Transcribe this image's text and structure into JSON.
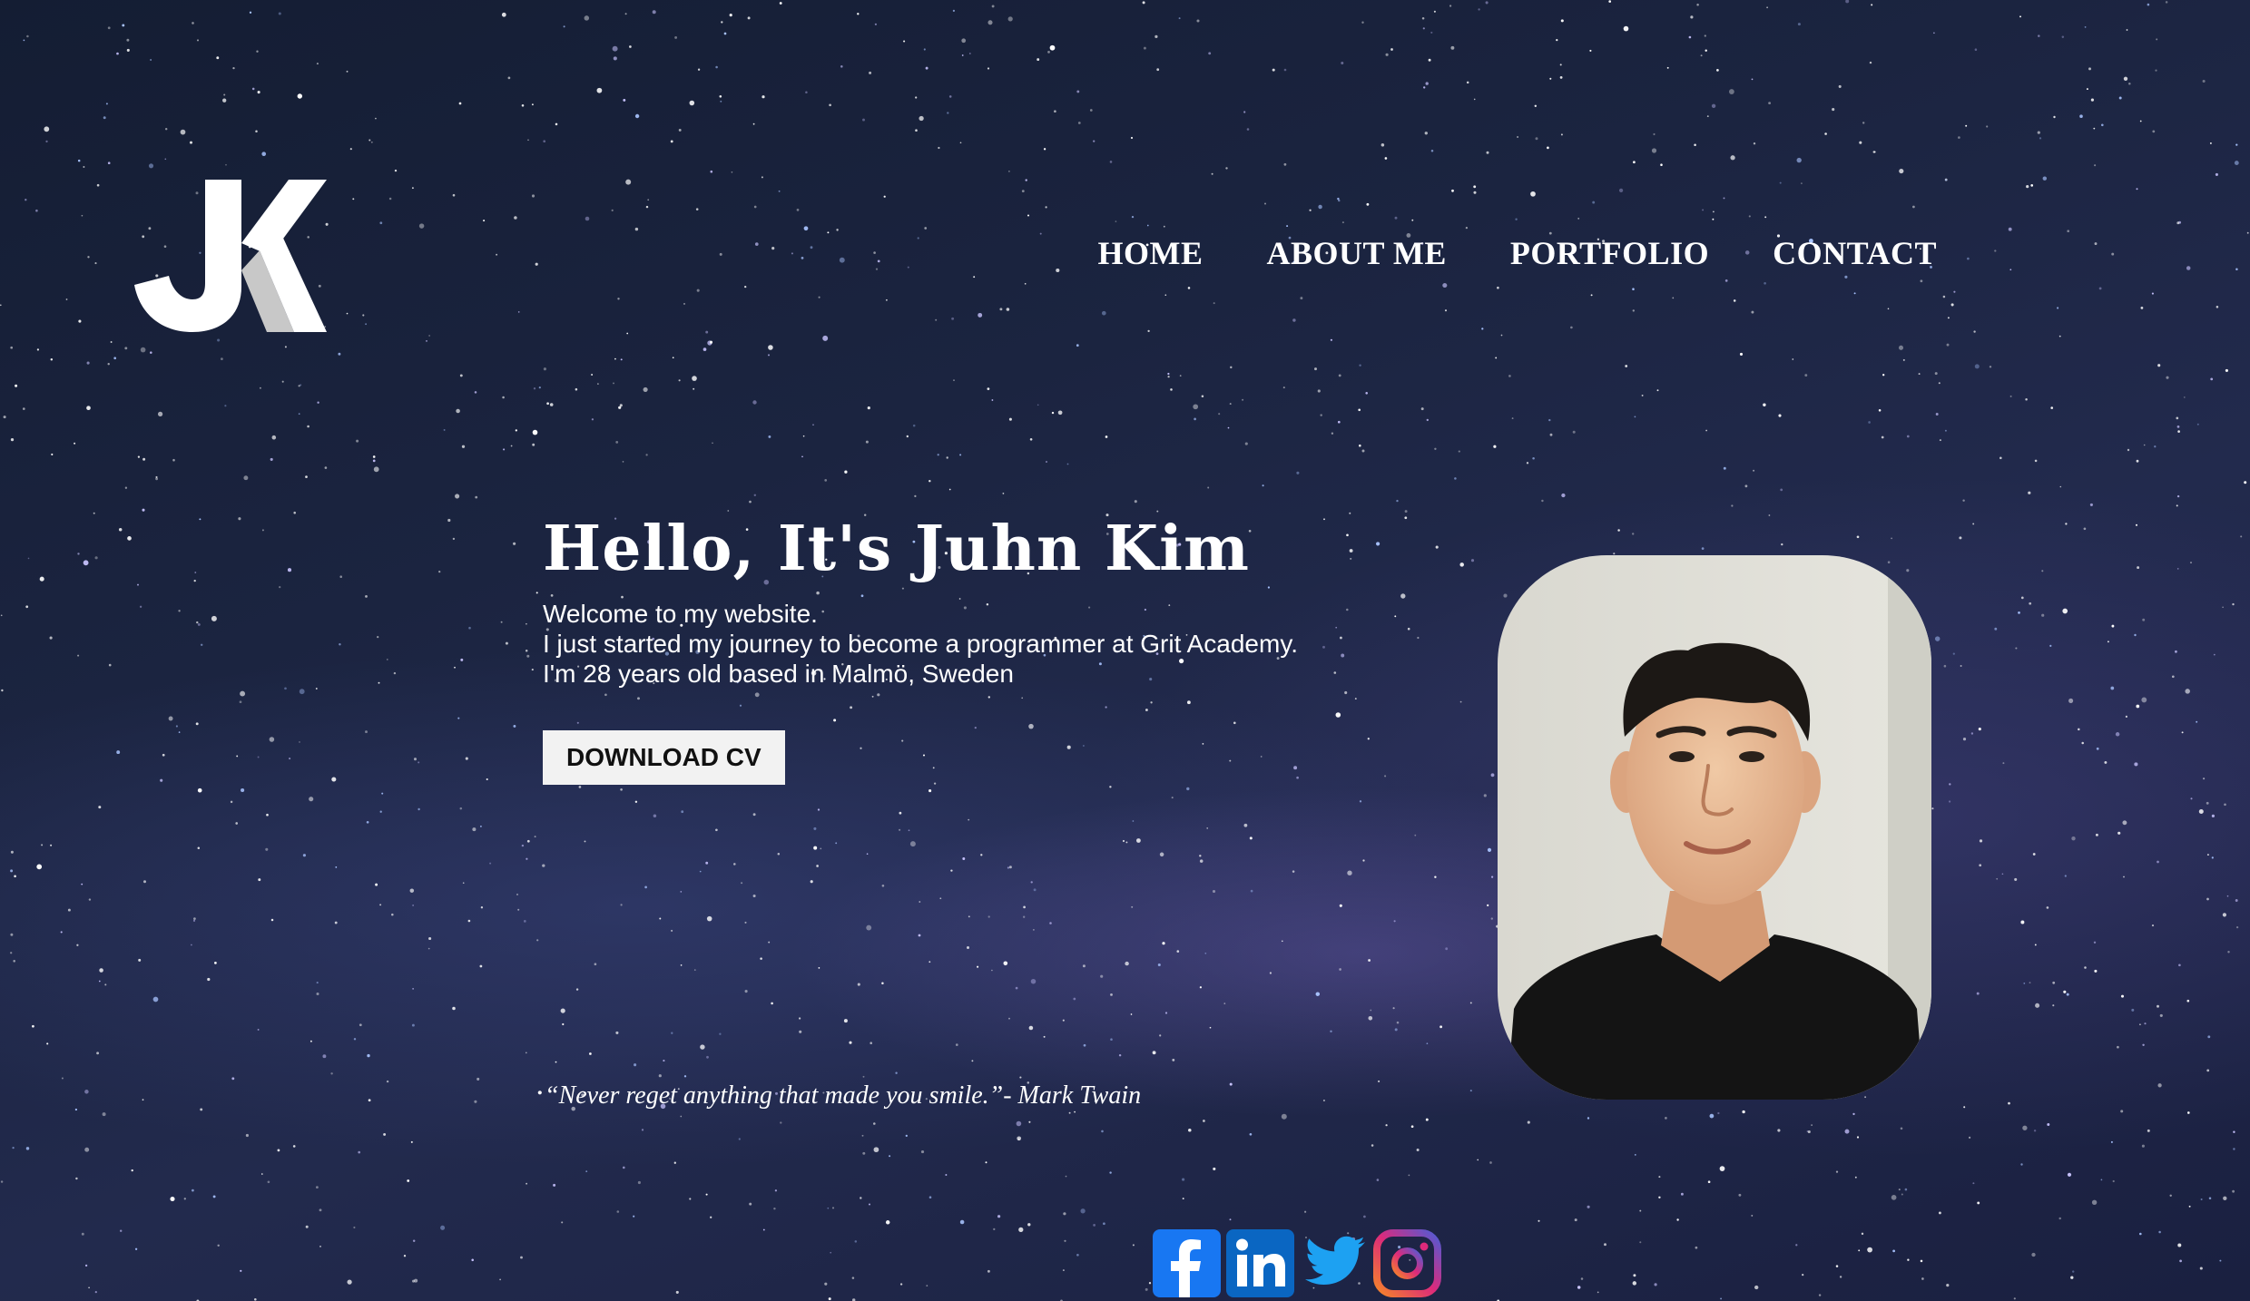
{
  "header": {
    "logo_text": "JK",
    "nav": [
      {
        "label": "HOME"
      },
      {
        "label": "ABOUT ME"
      },
      {
        "label": "PORTFOLIO"
      },
      {
        "label": "CONTACT"
      }
    ]
  },
  "hero": {
    "title": "Hello, It's Juhn Kim",
    "lines": [
      "Welcome to my website.",
      "I just started my journey to become a programmer at Grit Academy.",
      "I'm 28 years old based in Malmö, Sweden"
    ],
    "cv_button": "DOWNLOAD CV"
  },
  "quote": "“Never reget anything that made you smile.”- Mark Twain",
  "social": {
    "icons": [
      "facebook-icon",
      "linkedin-icon",
      "twitter-icon",
      "instagram-icon"
    ]
  },
  "colors": {
    "background": "#1b2440",
    "text": "#ffffff",
    "button_bg": "#f2f2f2",
    "facebook": "#1877f2",
    "linkedin": "#0a66c2",
    "twitter": "#1da1f2"
  }
}
